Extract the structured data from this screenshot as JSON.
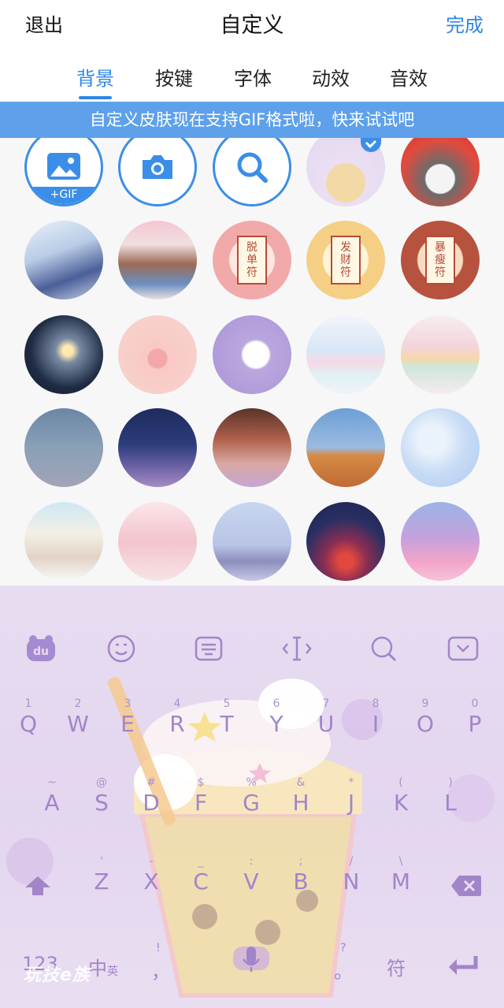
{
  "header": {
    "exit_label": "退出",
    "title": "自定义",
    "done_label": "完成"
  },
  "tabs": [
    {
      "label": "背景",
      "active": true
    },
    {
      "label": "按键",
      "active": false
    },
    {
      "label": "字体",
      "active": false
    },
    {
      "label": "动效",
      "active": false
    },
    {
      "label": "音效",
      "active": false
    }
  ],
  "banner": {
    "text": "自定义皮肤现在支持GIF格式啦，快来试试吧"
  },
  "tools": {
    "gallery_badge": "+GIF",
    "gallery_icon": "image-icon",
    "camera_icon": "camera-icon",
    "search_icon": "search-icon"
  },
  "backgrounds": {
    "fu_cards": [
      {
        "chars": [
          "脱",
          "单",
          "符"
        ]
      },
      {
        "chars": [
          "发",
          "财",
          "符"
        ]
      },
      {
        "chars": [
          "暴",
          "瘦",
          "符"
        ]
      }
    ],
    "selected_index": 0
  },
  "keyboard": {
    "toolbar_icons": [
      "du-logo-icon",
      "emoji-icon",
      "keyboard-layout-icon",
      "cursor-icon",
      "search-icon",
      "collapse-icon"
    ],
    "row1": [
      {
        "key": "Q",
        "hint": "1"
      },
      {
        "key": "W",
        "hint": "2"
      },
      {
        "key": "E",
        "hint": "3"
      },
      {
        "key": "R",
        "hint": "4"
      },
      {
        "key": "T",
        "hint": "5"
      },
      {
        "key": "Y",
        "hint": "6"
      },
      {
        "key": "U",
        "hint": "7"
      },
      {
        "key": "I",
        "hint": "8"
      },
      {
        "key": "O",
        "hint": "9"
      },
      {
        "key": "P",
        "hint": "0"
      }
    ],
    "row2": [
      {
        "key": "A",
        "hint": "~"
      },
      {
        "key": "S",
        "hint": "@"
      },
      {
        "key": "D",
        "hint": "#"
      },
      {
        "key": "F",
        "hint": "$"
      },
      {
        "key": "G",
        "hint": "%"
      },
      {
        "key": "H",
        "hint": "&"
      },
      {
        "key": "J",
        "hint": "*"
      },
      {
        "key": "K",
        "hint": "("
      },
      {
        "key": "L",
        "hint": ")"
      }
    ],
    "row3": [
      {
        "key": "Z",
        "hint": "'"
      },
      {
        "key": "X",
        "hint": "-"
      },
      {
        "key": "C",
        "hint": "_"
      },
      {
        "key": "V",
        "hint": ":"
      },
      {
        "key": "B",
        "hint": ";"
      },
      {
        "key": "N",
        "hint": "/"
      },
      {
        "key": "M",
        "hint": "\\"
      }
    ],
    "bottom": {
      "num_label": "123",
      "lang_label": "中",
      "lang_sub": "英",
      "comma_label": "，",
      "comma_hint": "!",
      "period_label": "。",
      "period_hint": "?",
      "symbol_label": "符"
    },
    "watermark": "玩技e族"
  },
  "colors": {
    "accent": "#2f86e6",
    "banner": "#5ea1ea",
    "key_text": "#a285c9"
  }
}
